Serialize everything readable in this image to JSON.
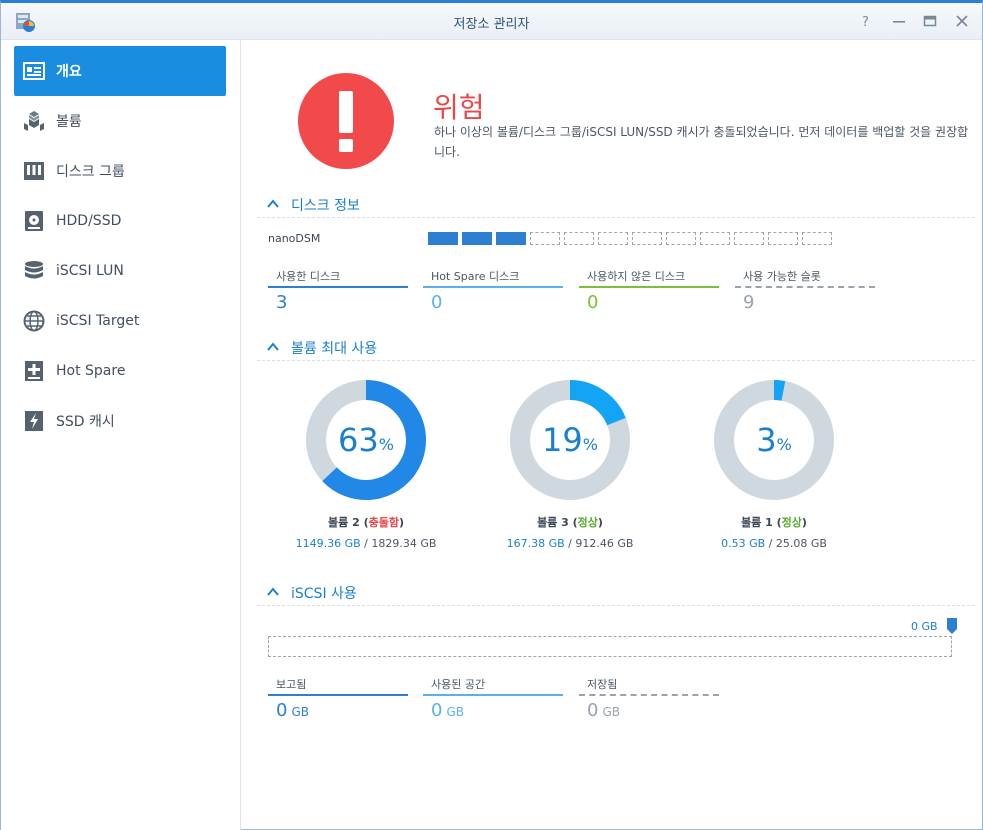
{
  "window": {
    "title": "저장소 관리자"
  },
  "sidebar": {
    "items": [
      {
        "label": "개요",
        "icon": "overview-icon",
        "active": true
      },
      {
        "label": "볼륨",
        "icon": "volume-icon"
      },
      {
        "label": "디스크 그룹",
        "icon": "disk-group-icon"
      },
      {
        "label": "HDD/SSD",
        "icon": "hdd-icon"
      },
      {
        "label": "iSCSI LUN",
        "icon": "iscsi-lun-icon"
      },
      {
        "label": "iSCSI Target",
        "icon": "iscsi-target-icon"
      },
      {
        "label": "Hot Spare",
        "icon": "hot-spare-icon"
      },
      {
        "label": "SSD 캐시",
        "icon": "ssd-cache-icon"
      }
    ]
  },
  "status": {
    "title": "위험",
    "description": "하나 이상의 볼륨/디스크 그룹/iSCSI LUN/SSD 캐시가 충돌되었습니다. 먼저 데이터를 백업할 것을 권장합니다."
  },
  "disk_info": {
    "heading": "디스크 정보",
    "host": "nanoDSM",
    "slots_used": 3,
    "slots_total": 12,
    "stats": [
      {
        "label": "사용한 디스크",
        "value": "3",
        "color": "#2d7fd2"
      },
      {
        "label": "Hot Spare 디스크",
        "value": "0",
        "color": "#5ab0ea"
      },
      {
        "label": "사용하지 않은 디스크",
        "value": "0",
        "color": "#7bbf3a"
      },
      {
        "label": "사용 가능한 슬롯",
        "value": "9",
        "color": "#9aa3ad"
      }
    ]
  },
  "volume_usage": {
    "heading": "볼륨 최대 사용",
    "volumes": [
      {
        "name": "볼륨 2",
        "status": "충돌함",
        "status_color": "#e84848",
        "percent": 63,
        "percent_text": "63",
        "pct_sign": "%",
        "used": "1149.36 GB",
        "total": "1829.34 GB"
      },
      {
        "name": "볼륨 3",
        "status": "정상",
        "status_color": "#5aa832",
        "percent": 19,
        "percent_text": "19",
        "pct_sign": "%",
        "used": "167.38 GB",
        "total": "912.46 GB"
      },
      {
        "name": "볼륨 1",
        "status": "정상",
        "status_color": "#5aa832",
        "percent": 3,
        "percent_text": "3",
        "pct_sign": "%",
        "used": "0.53 GB",
        "total": "25.08 GB"
      }
    ]
  },
  "iscsi": {
    "heading": "iSCSI 사용",
    "usage_label": "0 GB",
    "stats": [
      {
        "label": "보고됨",
        "value": "0",
        "unit": "GB",
        "color": "#2d7fd2"
      },
      {
        "label": "사용된 공간",
        "value": "0",
        "unit": "GB",
        "color": "#5ab0ea"
      },
      {
        "label": "저장됨",
        "value": "0",
        "unit": "GB",
        "color": "#9aa3ad"
      }
    ]
  },
  "colors": {
    "accent": "#1a8de0",
    "danger": "#f24a4a",
    "donut_track": "#cfd7df",
    "donut_fill_dark": "#2288e8",
    "donut_fill_light": "#13a4f5"
  }
}
